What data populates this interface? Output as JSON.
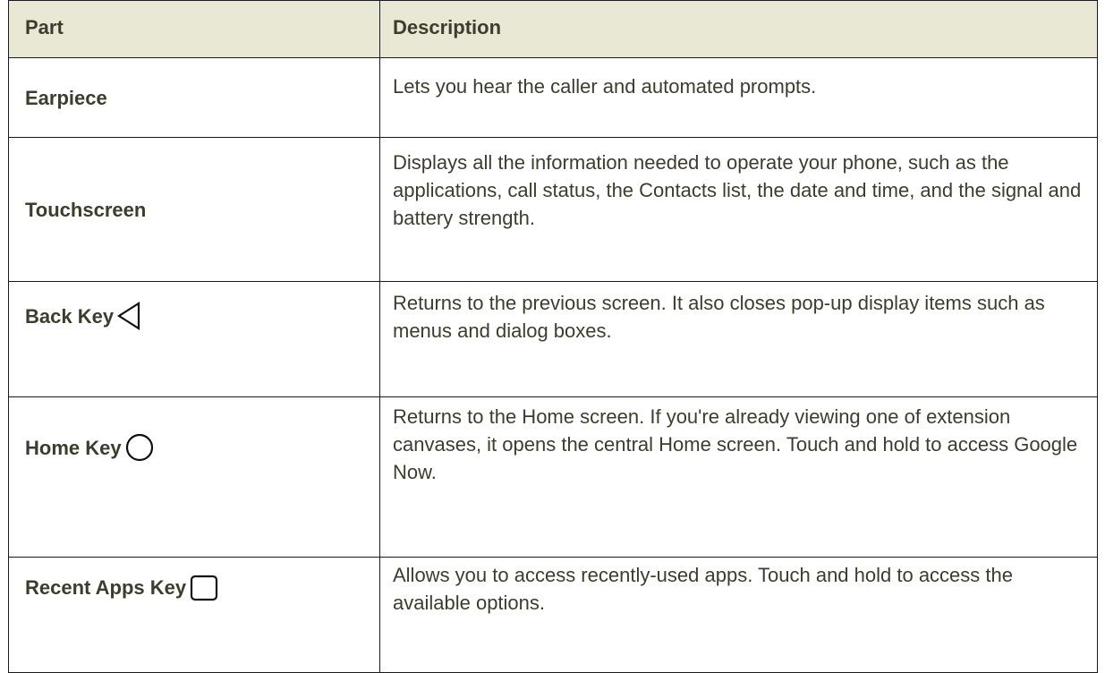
{
  "table": {
    "headers": {
      "part": "Part",
      "description": "Description"
    },
    "rows": [
      {
        "part": "Earpiece",
        "icon": null,
        "description": "Lets you hear the caller and automated prompts."
      },
      {
        "part": "Touchscreen",
        "icon": null,
        "description": "Displays all the information needed to operate your phone, such as the applications, call status, the Contacts list, the date and time, and the signal and battery strength."
      },
      {
        "part": "Back Key",
        "icon": "back-triangle-icon",
        "description": "Returns to the previous screen. It also closes pop-up display items such as menus and dialog boxes."
      },
      {
        "part": "Home Key",
        "icon": "home-circle-icon",
        "description": "Returns to the Home screen. If you're already viewing one of extension canvases, it opens the central Home screen. Touch and hold to access Google Now."
      },
      {
        "part": "Recent Apps Key",
        "icon": "recent-apps-square-icon",
        "description": "Allows you to access recently-used apps. Touch and hold to access the available options."
      }
    ]
  },
  "colors": {
    "header_background": "#e8e8d4",
    "text": "#3d3d2e",
    "border": "#1a1a1a"
  }
}
